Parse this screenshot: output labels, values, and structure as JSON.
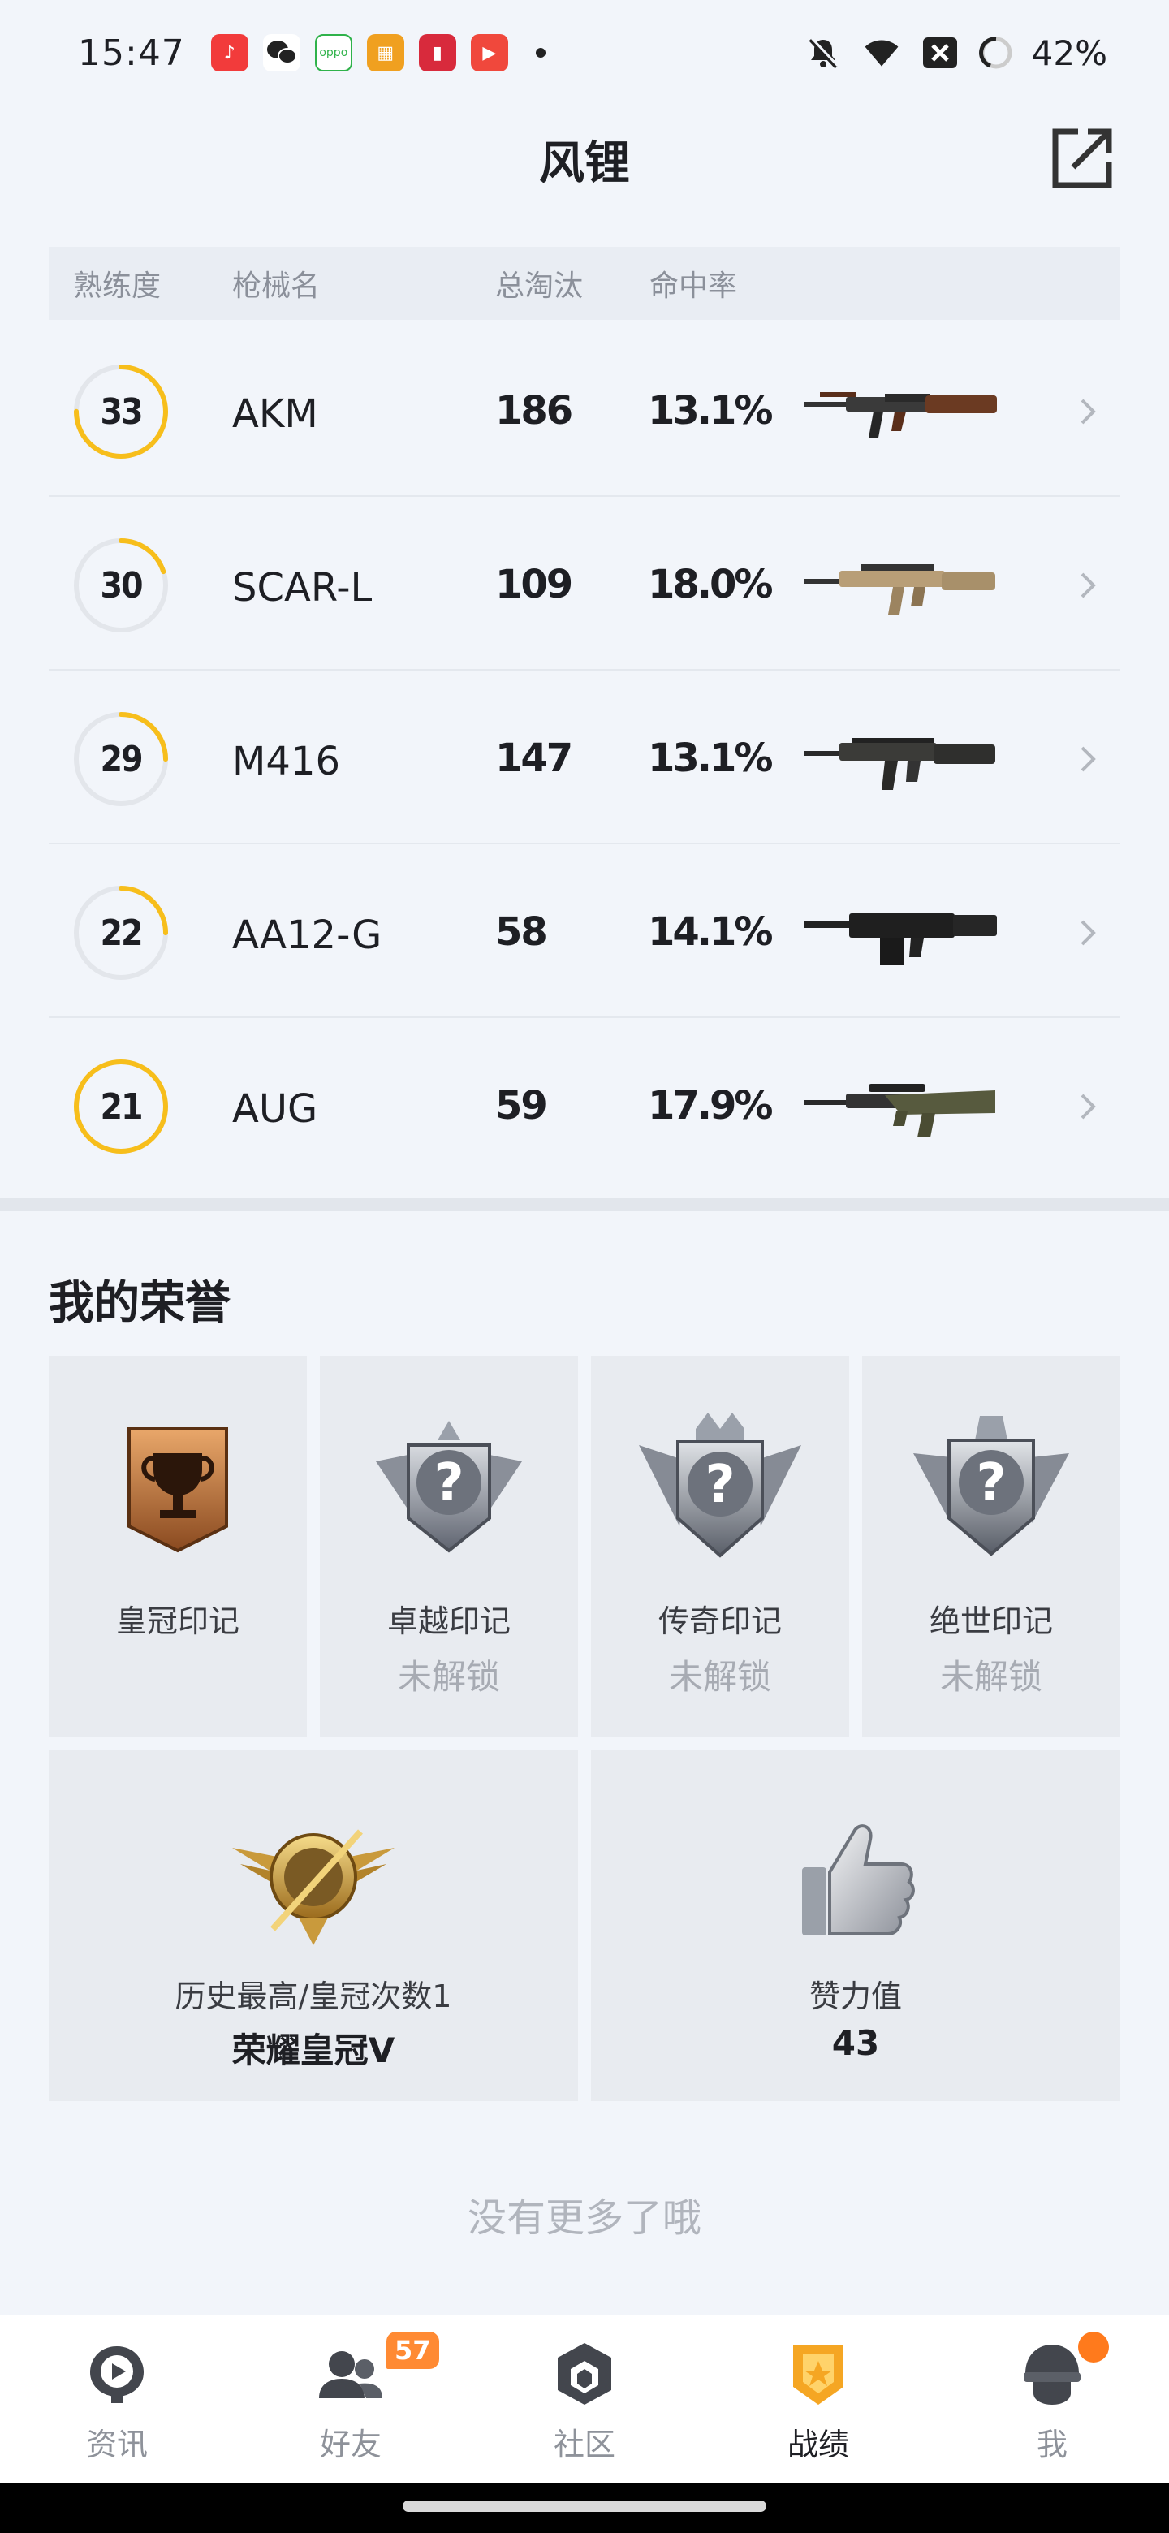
{
  "status_bar": {
    "time": "15:47",
    "battery": "42%",
    "apps": [
      {
        "name": "music-app-icon",
        "color": "#f23b3b",
        "glyph": "♪"
      },
      {
        "name": "wechat-app-icon",
        "color": "#ffffff",
        "glyph": "●"
      },
      {
        "name": "oppo-app-icon",
        "color": "#2fb24a",
        "glyph": "oppo"
      },
      {
        "name": "game-app-icon",
        "color": "#f0a020",
        "glyph": "▦"
      },
      {
        "name": "red-app-icon",
        "color": "#d82a3c",
        "glyph": "▮"
      },
      {
        "name": "video-app-icon",
        "color": "#f0483c",
        "glyph": "▶"
      }
    ]
  },
  "header": {
    "title": "风锂",
    "share_icon": "share-external-icon"
  },
  "table": {
    "headers": {
      "mastery": "熟练度",
      "weapon": "枪械名",
      "kills": "总淘汰",
      "accuracy": "命中率"
    },
    "rows": [
      {
        "level": "33",
        "name": "AKM",
        "kills": "186",
        "accuracy": "13.1%",
        "ring_progress": 0.75,
        "image": "akm-rifle-image"
      },
      {
        "level": "30",
        "name": "SCAR-L",
        "kills": "109",
        "accuracy": "18.0%",
        "ring_progress": 0.2,
        "image": "scar-l-rifle-image"
      },
      {
        "level": "29",
        "name": "M416",
        "kills": "147",
        "accuracy": "13.1%",
        "ring_progress": 0.25,
        "image": "m416-rifle-image"
      },
      {
        "level": "22",
        "name": "AA12-G",
        "kills": "58",
        "accuracy": "14.1%",
        "ring_progress": 0.25,
        "image": "aa12-shotgun-image"
      },
      {
        "level": "21",
        "name": "AUG",
        "kills": "59",
        "accuracy": "17.9%",
        "ring_progress": 1.0,
        "image": "aug-rifle-image"
      }
    ]
  },
  "honors": {
    "title": "我的荣誉",
    "marks": [
      {
        "name": "皇冠印记",
        "locked_text": "",
        "icon": "crown-trophy-badge-icon"
      },
      {
        "name": "卓越印记",
        "locked_text": "未解锁",
        "icon": "locked-excellence-badge-icon"
      },
      {
        "name": "传奇印记",
        "locked_text": "未解锁",
        "icon": "locked-legend-badge-icon"
      },
      {
        "name": "绝世印记",
        "locked_text": "未解锁",
        "icon": "locked-peerless-badge-icon"
      }
    ],
    "stats": [
      {
        "label": "历史最高/皇冠次数1",
        "value": "荣耀皇冠V",
        "icon": "glory-crown-rank-icon"
      },
      {
        "label": "赞力值",
        "value": "43",
        "icon": "thumbs-up-icon"
      }
    ]
  },
  "footer_text": "没有更多了哦",
  "bottom_nav": {
    "items": [
      {
        "label": "资讯",
        "icon": "news-icon",
        "badge": ""
      },
      {
        "label": "好友",
        "icon": "friends-icon",
        "badge": "57"
      },
      {
        "label": "社区",
        "icon": "community-icon",
        "badge": ""
      },
      {
        "label": "战绩",
        "icon": "record-icon",
        "badge": "",
        "active": true
      },
      {
        "label": "我",
        "icon": "profile-icon",
        "badge": "",
        "dot": true
      }
    ]
  },
  "colors": {
    "accent": "#f7be1b",
    "ring_track": "#e3e6eb",
    "active_nav": "#f5a623"
  }
}
